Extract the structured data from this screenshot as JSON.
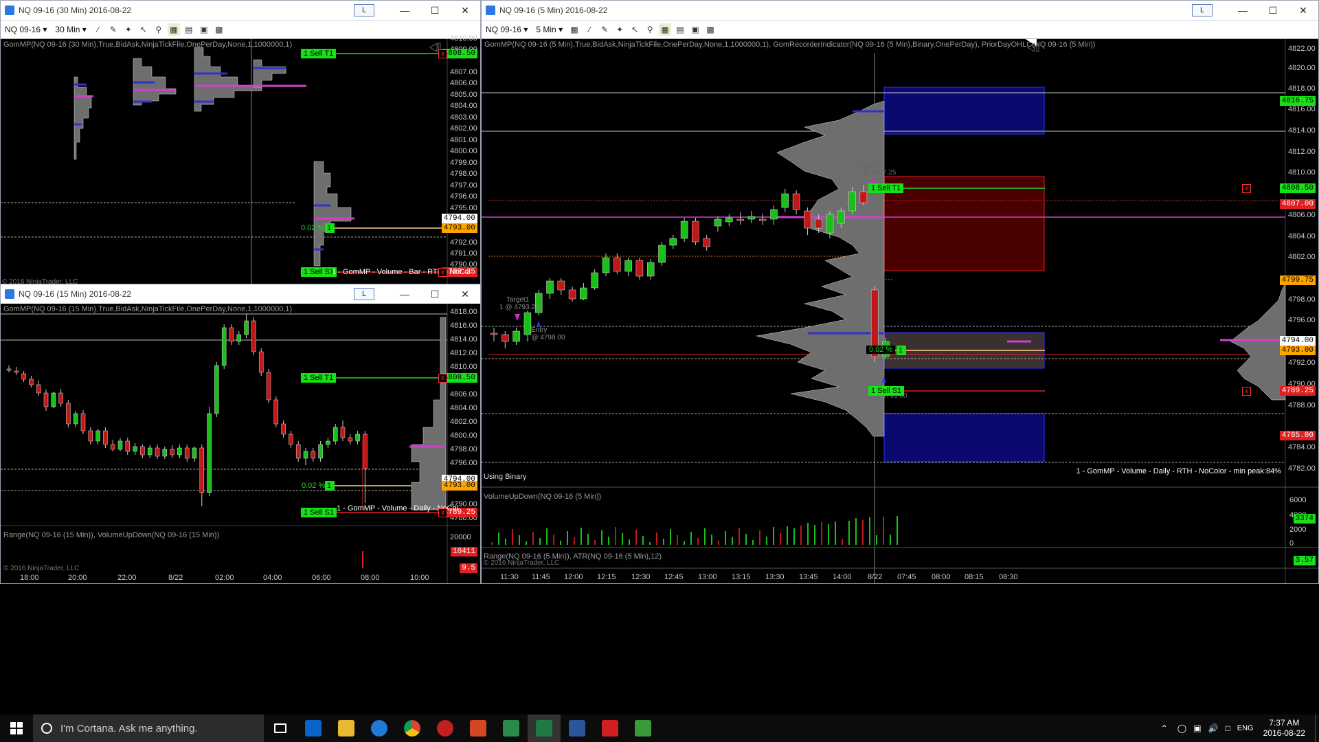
{
  "windows": {
    "w30": {
      "title": "NQ 09-16 (30 Min)  2016-08-22",
      "l_label": "L",
      "instrument": "NQ 09-16",
      "interval": "30 Min",
      "indicator": "GomMP(NQ 09-16 (30 Min),True,BidAsk,NinjaTickFile,OnePerDay,None,1,1000000,1)",
      "copyright": "© 2016 NinjaTrader, LLC",
      "sell_t1": "1  Sell T1",
      "sell_s1": "1  Sell S1",
      "pct": "0.02 %",
      "pos": "1",
      "profile_label": "1 - GomMP - Volume - Bar - RTH - NoCol",
      "price_axis": [
        "4810.00",
        "4809.00",
        "4808.00",
        "4807.00",
        "4806.00",
        "4805.00",
        "4804.00",
        "4803.00",
        "4802.00",
        "4801.00",
        "4800.00",
        "4799.00",
        "4798.00",
        "4797.00",
        "4796.00",
        "4795.00",
        "4794.00",
        "4793.00",
        "4792.00",
        "4791.00",
        "4790.00"
      ],
      "tags": {
        "sell_t1": "4808.50",
        "last": "4794.00",
        "entry": "4793.00",
        "stop": "4789.25"
      }
    },
    "w15": {
      "title": "NQ 09-16 (15 Min)  2016-08-22",
      "l_label": "L",
      "indicator": "GomMP(NQ 09-16 (15 Min),True,BidAsk,NinjaTickFile,OnePerDay,None,1,1000000,1)",
      "sub_indicator": "Range(NQ 09-16 (15 Min)), VolumeUpDown(NQ 09-16 (15 Min))",
      "copyright": "© 2016 NinjaTrader, LLC",
      "sell_t1": "1  Sell T1",
      "sell_s1": "1  Sell S1",
      "pct": "0.02 %",
      "pos": "1",
      "profile_label": "1 - GomMP - Volume - Daily - NoCol",
      "price_axis": [
        "4818.00",
        "4816.00",
        "4814.00",
        "4812.00",
        "4810.00",
        "4808.00",
        "4806.00",
        "4804.00",
        "4802.00",
        "4800.00",
        "4798.00",
        "4796.00",
        "4794.00",
        "4792.00",
        "4790.00",
        "4788.00"
      ],
      "sub_axis": [
        "20000",
        "0"
      ],
      "time_axis": [
        "18:00",
        "20:00",
        "22:00",
        "8/22",
        "02:00",
        "04:00",
        "06:00",
        "08:00",
        "10:00"
      ],
      "tags": {
        "sell_t1": "4808.50",
        "last": "4794.00",
        "entry": "4793.00",
        "stop": "4789.25",
        "range": "10411",
        "atr": "9.5"
      }
    },
    "w5": {
      "title": "NQ 09-16 (5 Min)  2016-08-22",
      "l_label": "L",
      "instrument": "NQ 09-16",
      "interval": "5 Min",
      "indicator": "GomMP(NQ 09-16 (5 Min),True,BidAsk,NinjaTickFile,OnePerDay,None,1,1000000,1), GomRecorderIndicator(NQ 09-16 (5 Min),Binary,OnePerDay), PriorDayOHLC(NQ 09-16 (5 Min))",
      "vol_indicator": "VolumeUpDown(NQ 09-16 (5 Min))",
      "range_indicator": "Range(NQ 09-16 (5 Min)), ATR(NQ 09-16 (5 Min),12)",
      "copyright": "© 2016 NinjaTrader, LLC",
      "using_binary": "Using Binary",
      "profile_label": "1 - GomMP - Volume - Daily - RTH - NoColor - min peak:84%",
      "sell_t1": "1  Sell T1",
      "sell_s1": "1  Sell S1",
      "pct": "0.02 %",
      "pos": "1",
      "target_a_1": "Target1",
      "target_a_2": "1 @ 4807.25",
      "target_b_1": "Target1",
      "target_b_2": "1 @ 4793.25",
      "entry_1": "Entry",
      "entry_2": "1 @ 4798.00",
      "stop_2": "1 @ 4793.00",
      "price_axis": [
        "4822.00",
        "4820.00",
        "4818.00",
        "4816.00",
        "4814.00",
        "4812.00",
        "4810.00",
        "4808.00",
        "4806.00",
        "4804.00",
        "4802.00",
        "4800.00",
        "4798.00",
        "4796.00",
        "4794.00",
        "4792.00",
        "4790.00",
        "4788.00",
        "4786.00",
        "4784.00",
        "4782.00"
      ],
      "vol_axis": [
        "6000",
        "4000",
        "2000",
        "0"
      ],
      "time_axis": [
        "11:30",
        "11:45",
        "12:00",
        "12:15",
        "12:30",
        "12:45",
        "13:00",
        "13:15",
        "13:30",
        "13:45",
        "14:00",
        "8/22",
        "07:45",
        "08:00",
        "08:15",
        "08:30"
      ],
      "tags": {
        "prior_high": "4816.75",
        "sell_t1": "4808.50",
        "red1": "4807.00",
        "orange": "4799.75",
        "last": "4794.00",
        "entry": "4793.00",
        "stop": "4789.25",
        "low": "4785.00",
        "vol": "3374",
        "atr": "3.57"
      }
    }
  },
  "taskbar": {
    "cortana": "I'm Cortana. Ask me anything.",
    "lang": "ENG",
    "time": "7:37 AM",
    "date": "2016-08-22"
  },
  "colors": {
    "green": "#18e018",
    "red": "#e02020",
    "magenta": "#d040d0",
    "blue": "#3030d0",
    "orange": "#ffa500",
    "gray": "#6e6e6e"
  }
}
